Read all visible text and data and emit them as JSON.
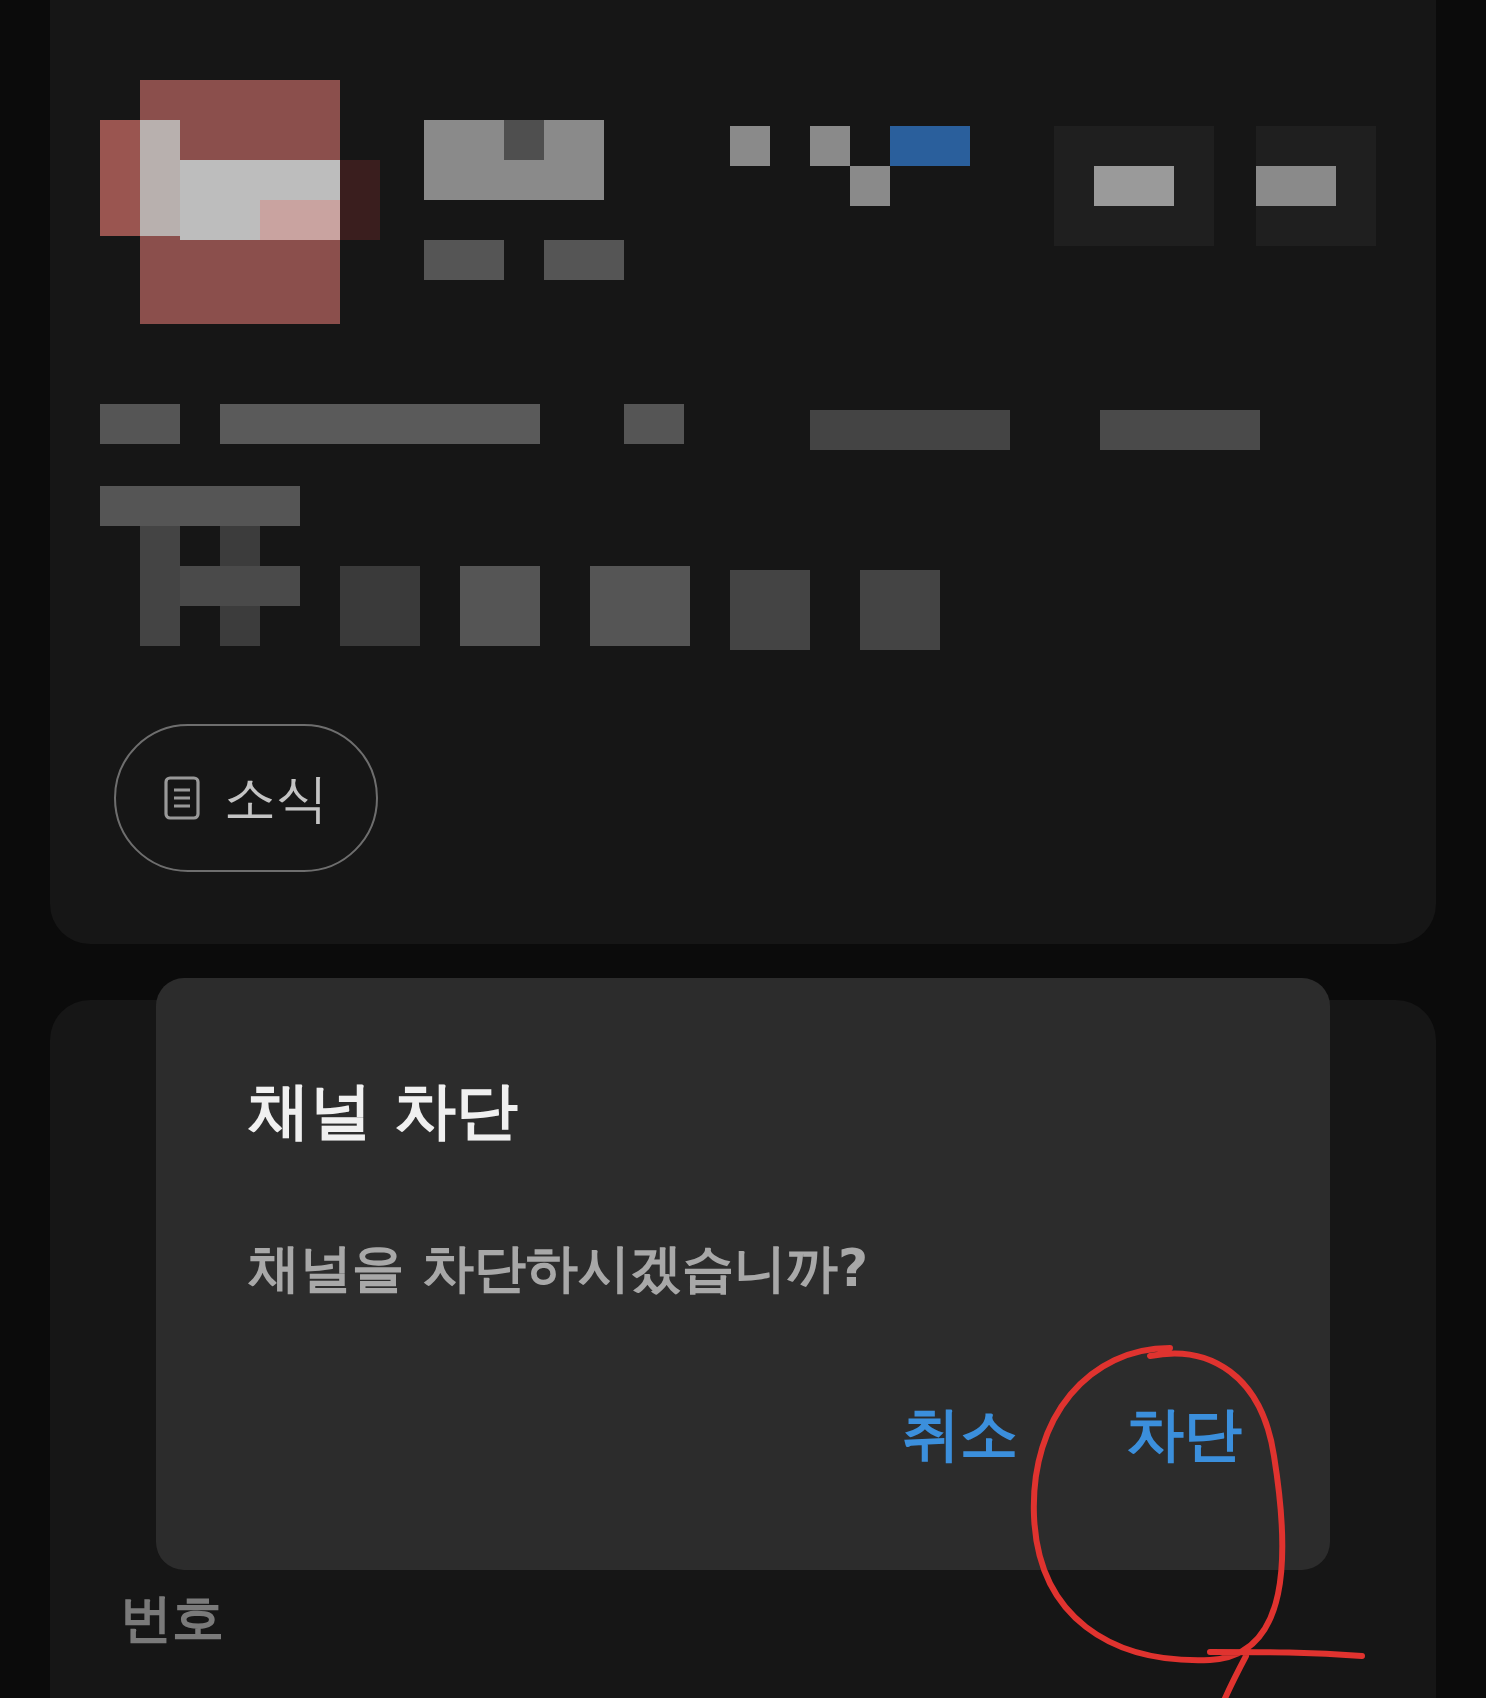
{
  "card": {
    "news_button": "소식"
  },
  "background_labels": [
    "번호"
  ],
  "dialog": {
    "title": "채널 차단",
    "message": "채널을 차단하시겠습니까?",
    "buttons": [
      {
        "label": "취소"
      },
      {
        "label": "차단"
      }
    ]
  }
}
